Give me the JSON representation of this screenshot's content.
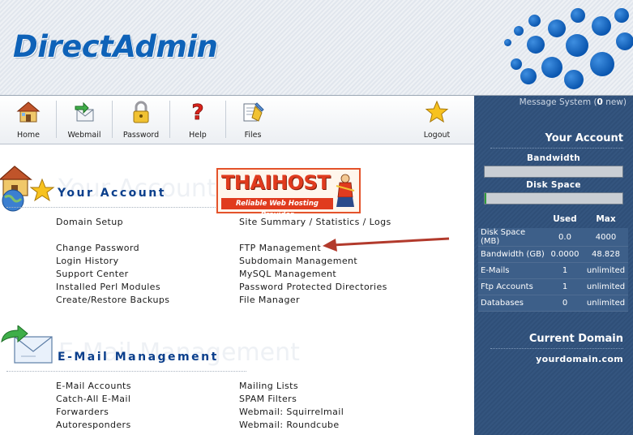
{
  "app": {
    "title": "DirectAdmin"
  },
  "colors": {
    "brand": "#0e62b8",
    "panel": "#34557f",
    "link": "#1b1b1b",
    "section_title": "#0b3f8c",
    "accent_red": "#e03b1e"
  },
  "toolbar": {
    "items": [
      {
        "label": "Home",
        "icon": "home-icon"
      },
      {
        "label": "Webmail",
        "icon": "webmail-icon"
      },
      {
        "label": "Password",
        "icon": "lock-icon"
      },
      {
        "label": "Help",
        "icon": "help-icon"
      },
      {
        "label": "Files",
        "icon": "files-icon"
      },
      {
        "label": "Logout",
        "icon": "star-icon"
      }
    ]
  },
  "messages": {
    "prefix": "Message System (",
    "count": "0",
    "suffix": " new)"
  },
  "account_panel": {
    "title": "Your Account",
    "bandwidth_label": "Bandwidth",
    "bandwidth_fraction": 0.0,
    "disk_label": "Disk Space",
    "disk_fraction": 0.01,
    "col_used": "Used",
    "col_max": "Max",
    "rows": [
      {
        "name": "Disk Space (MB)",
        "used": "0.0",
        "max": "4000"
      },
      {
        "name": "Bandwidth (GB)",
        "used": "0.0000",
        "max": "48.828"
      },
      {
        "name": "E-Mails",
        "used": "1",
        "max": "unlimited"
      },
      {
        "name": "Ftp Accounts",
        "used": "1",
        "max": "unlimited"
      },
      {
        "name": "Databases",
        "used": "0",
        "max": "unlimited"
      }
    ]
  },
  "current_domain": {
    "title": "Current Domain",
    "name": "yourdomain.com"
  },
  "your_account": {
    "title": "Your Account",
    "ghost": "Your Account",
    "col1": [
      "Domain Setup",
      "Change Password",
      "Login History",
      "Support Center",
      "Installed Perl Modules",
      "Create/Restore Backups"
    ],
    "col2": [
      "Site Summary / Statistics / Logs",
      "FTP Management",
      "Subdomain Management",
      "MySQL Management",
      "Password Protected Directories",
      "File Manager"
    ]
  },
  "banner": {
    "title": "THAIHOST",
    "tagline": "Reliable Web Hosting Provider"
  },
  "email_management": {
    "title": "E-Mail Management",
    "ghost": "E-Mail Management",
    "col1": [
      "E-Mail Accounts",
      "Catch-All E-Mail",
      "Forwarders",
      "Autoresponders"
    ],
    "col2": [
      "Mailing Lists",
      "SPAM Filters",
      "Webmail: Squirrelmail",
      "Webmail: Roundcube"
    ]
  }
}
